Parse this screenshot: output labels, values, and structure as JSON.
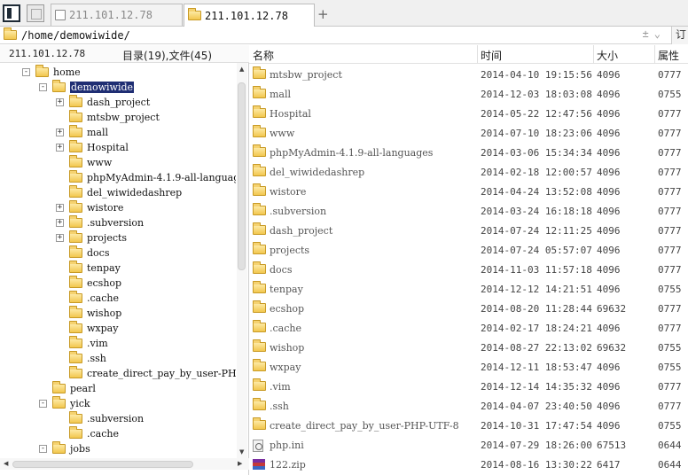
{
  "tabs": [
    {
      "label": "211.101.12.78",
      "active": false
    },
    {
      "label": "211.101.12.78",
      "active": true
    }
  ],
  "path": "/home/demowiwide/",
  "right_strip_text": "订",
  "left_panel": {
    "host": "211.101.12.78",
    "counts": "目录(19),文件(45)"
  },
  "tree": [
    {
      "label": "home",
      "depth": 0,
      "toggle": "-"
    },
    {
      "label": "demowiwide",
      "depth": 1,
      "toggle": "-",
      "selected": true
    },
    {
      "label": "dash_project",
      "depth": 2,
      "toggle": "+"
    },
    {
      "label": "mtsbw_project",
      "depth": 2,
      "toggle": ""
    },
    {
      "label": "mall",
      "depth": 2,
      "toggle": "+"
    },
    {
      "label": "Hospital",
      "depth": 2,
      "toggle": "+"
    },
    {
      "label": "www",
      "depth": 2,
      "toggle": ""
    },
    {
      "label": "phpMyAdmin-4.1.9-all-languag",
      "depth": 2,
      "toggle": ""
    },
    {
      "label": "del_wiwidedashrep",
      "depth": 2,
      "toggle": ""
    },
    {
      "label": "wistore",
      "depth": 2,
      "toggle": "+"
    },
    {
      "label": ".subversion",
      "depth": 2,
      "toggle": "+"
    },
    {
      "label": "projects",
      "depth": 2,
      "toggle": "+"
    },
    {
      "label": "docs",
      "depth": 2,
      "toggle": ""
    },
    {
      "label": "tenpay",
      "depth": 2,
      "toggle": ""
    },
    {
      "label": "ecshop",
      "depth": 2,
      "toggle": ""
    },
    {
      "label": ".cache",
      "depth": 2,
      "toggle": ""
    },
    {
      "label": "wishop",
      "depth": 2,
      "toggle": ""
    },
    {
      "label": "wxpay",
      "depth": 2,
      "toggle": ""
    },
    {
      "label": ".vim",
      "depth": 2,
      "toggle": ""
    },
    {
      "label": ".ssh",
      "depth": 2,
      "toggle": ""
    },
    {
      "label": "create_direct_pay_by_user-PH",
      "depth": 2,
      "toggle": ""
    },
    {
      "label": "pearl",
      "depth": 1,
      "toggle": ""
    },
    {
      "label": "yick",
      "depth": 1,
      "toggle": "-"
    },
    {
      "label": ".subversion",
      "depth": 2,
      "toggle": ""
    },
    {
      "label": ".cache",
      "depth": 2,
      "toggle": ""
    },
    {
      "label": "jobs",
      "depth": 1,
      "toggle": "-"
    }
  ],
  "columns": {
    "name": "名称",
    "time": "时间",
    "size": "大小",
    "perm": "属性"
  },
  "files": [
    {
      "name": "mtsbw_project",
      "time": "2014-04-10 19:15:56",
      "size": "4096",
      "perm": "0777",
      "icon": "folder"
    },
    {
      "name": "mall",
      "time": "2014-12-03 18:03:08",
      "size": "4096",
      "perm": "0755",
      "icon": "folder"
    },
    {
      "name": "Hospital",
      "time": "2014-05-22 12:47:56",
      "size": "4096",
      "perm": "0777",
      "icon": "folder"
    },
    {
      "name": "www",
      "time": "2014-07-10 18:23:06",
      "size": "4096",
      "perm": "0777",
      "icon": "folder"
    },
    {
      "name": "phpMyAdmin-4.1.9-all-languages",
      "time": "2014-03-06 15:34:34",
      "size": "4096",
      "perm": "0777",
      "icon": "folder"
    },
    {
      "name": "del_wiwidedashrep",
      "time": "2014-02-18 12:00:57",
      "size": "4096",
      "perm": "0777",
      "icon": "folder"
    },
    {
      "name": "wistore",
      "time": "2014-04-24 13:52:08",
      "size": "4096",
      "perm": "0777",
      "icon": "folder"
    },
    {
      "name": ".subversion",
      "time": "2014-03-24 16:18:18",
      "size": "4096",
      "perm": "0777",
      "icon": "folder"
    },
    {
      "name": "dash_project",
      "time": "2014-07-24 12:11:25",
      "size": "4096",
      "perm": "0777",
      "icon": "folder"
    },
    {
      "name": "projects",
      "time": "2014-07-24 05:57:07",
      "size": "4096",
      "perm": "0777",
      "icon": "folder"
    },
    {
      "name": "docs",
      "time": "2014-11-03 11:57:18",
      "size": "4096",
      "perm": "0777",
      "icon": "folder"
    },
    {
      "name": "tenpay",
      "time": "2014-12-12 14:21:51",
      "size": "4096",
      "perm": "0755",
      "icon": "folder"
    },
    {
      "name": "ecshop",
      "time": "2014-08-20 11:28:44",
      "size": "69632",
      "perm": "0777",
      "icon": "folder"
    },
    {
      "name": ".cache",
      "time": "2014-02-17 18:24:21",
      "size": "4096",
      "perm": "0777",
      "icon": "folder"
    },
    {
      "name": "wishop",
      "time": "2014-08-27 22:13:02",
      "size": "69632",
      "perm": "0755",
      "icon": "folder"
    },
    {
      "name": "wxpay",
      "time": "2014-12-11 18:53:47",
      "size": "4096",
      "perm": "0755",
      "icon": "folder"
    },
    {
      "name": ".vim",
      "time": "2014-12-14 14:35:32",
      "size": "4096",
      "perm": "0777",
      "icon": "folder"
    },
    {
      "name": ".ssh",
      "time": "2014-04-07 23:40:50",
      "size": "4096",
      "perm": "0777",
      "icon": "folder"
    },
    {
      "name": "create_direct_pay_by_user-PHP-UTF-8",
      "time": "2014-10-31 17:47:54",
      "size": "4096",
      "perm": "0755",
      "icon": "folder"
    },
    {
      "name": "php.ini",
      "time": "2014-07-29 18:26:00",
      "size": "67513",
      "perm": "0644",
      "icon": "file"
    },
    {
      "name": "122.zip",
      "time": "2014-08-16 13:30:22",
      "size": "6417",
      "perm": "0644",
      "icon": "zip"
    }
  ]
}
